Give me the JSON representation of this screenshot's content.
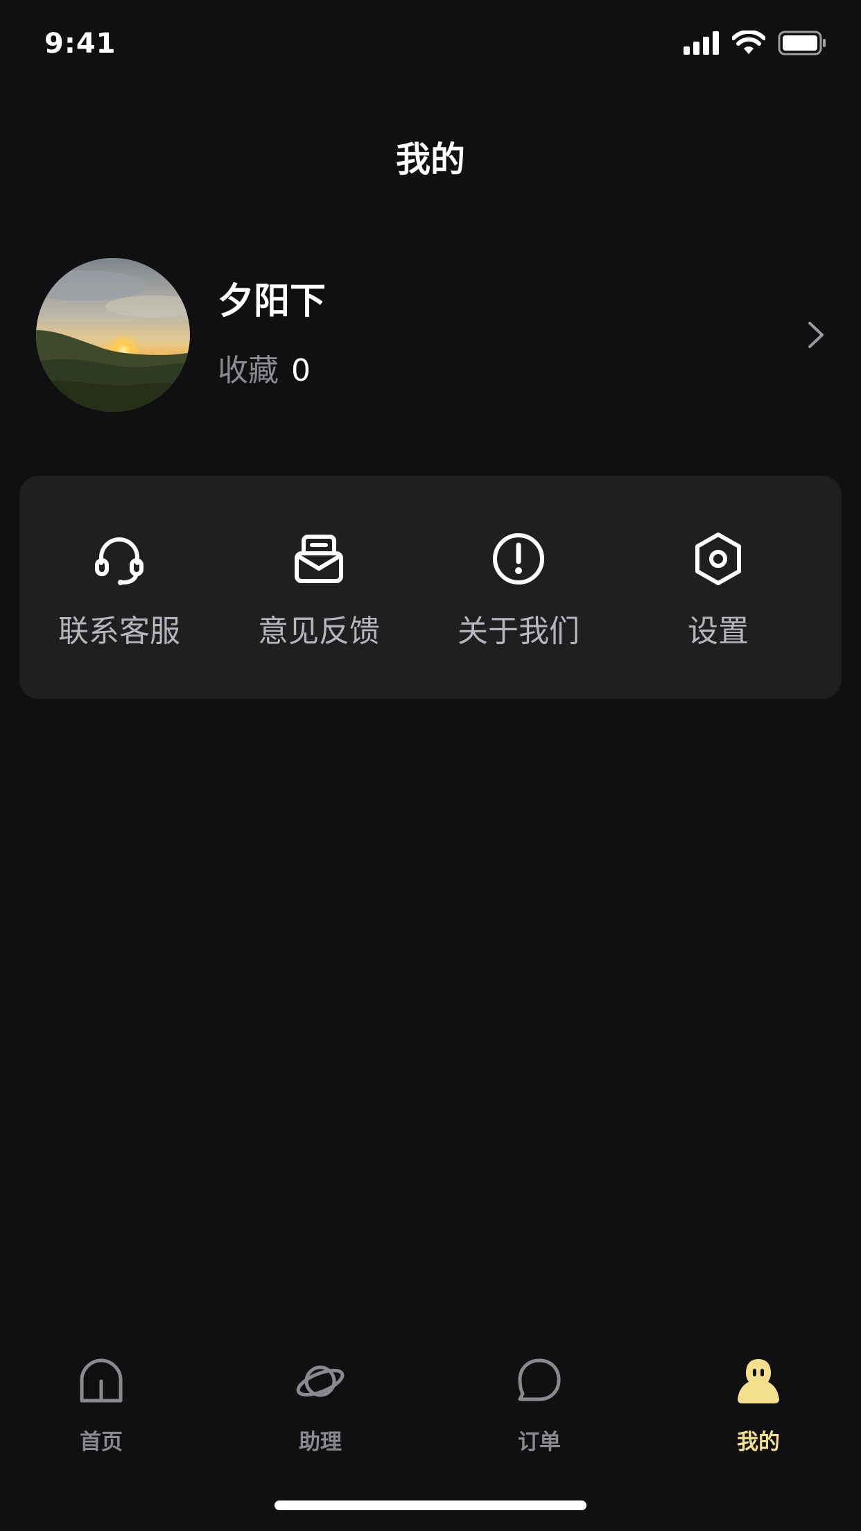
{
  "status_bar": {
    "time": "9:41",
    "icons": [
      "signal-icon",
      "wifi-icon",
      "battery-icon"
    ]
  },
  "header": {
    "title": "我的"
  },
  "profile": {
    "name": "夕阳下",
    "favorites_label": "收藏",
    "favorites_count": "0",
    "avatar": "sunset-landscape-photo",
    "chevron": "chevron-right-icon"
  },
  "menu": {
    "items": [
      {
        "label": "联系客服",
        "icon": "headset-icon"
      },
      {
        "label": "意见反馈",
        "icon": "mail-feedback-icon"
      },
      {
        "label": "关于我们",
        "icon": "info-exclamation-icon"
      },
      {
        "label": "设置",
        "icon": "hexagon-settings-icon"
      }
    ]
  },
  "tabbar": {
    "items": [
      {
        "label": "首页",
        "icon": "home-icon",
        "active": false
      },
      {
        "label": "助理",
        "icon": "planet-icon",
        "active": false
      },
      {
        "label": "订单",
        "icon": "chat-bubble-icon",
        "active": false
      },
      {
        "label": "我的",
        "icon": "profile-ghost-icon",
        "active": true
      }
    ]
  },
  "colors": {
    "background": "#101013",
    "card": "#1f1f22",
    "accent": "#f4df8f",
    "inactive": "#8a8a8e"
  }
}
